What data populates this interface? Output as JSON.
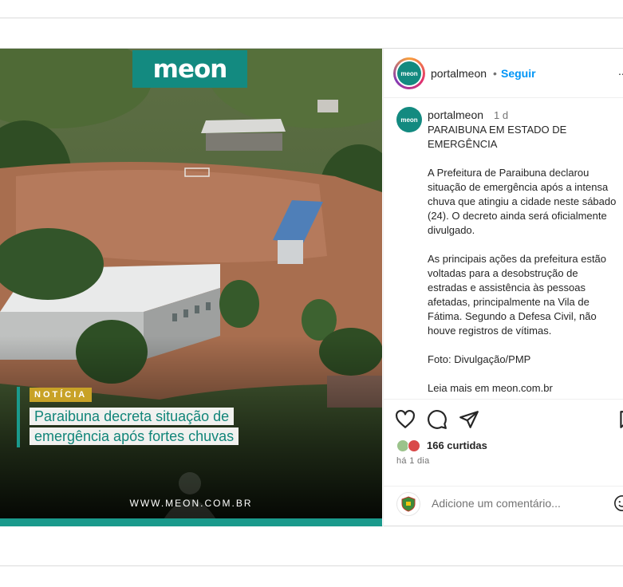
{
  "post": {
    "media": {
      "brand_logo": "meon",
      "tag": "NOTÍCIA",
      "headline": "Paraibuna decreta situação de emergência após fortes chuvas",
      "url_text": "WWW.MEON.COM.BR"
    },
    "header": {
      "avatar_text": "meon",
      "username": "portalmeon",
      "separator": "•",
      "follow_label": "Seguir",
      "more_label": "..."
    },
    "caption": {
      "avatar_text": "meon",
      "username": "portalmeon",
      "time": "1 d",
      "paragraphs": [
        "PARAIBUNA EM ESTADO DE EMERGÊNCIA",
        "A Prefeitura de Paraibuna declarou situação de emergência após a intensa chuva que atingiu a cidade neste sábado (24). O decreto ainda será oficialmente divulgado.",
        "As principais ações da prefeitura estão voltadas para a desobstrução de estradas e assistência às pessoas afetadas, principalmente na Vila de Fátima. Segundo a Defesa Civil, não houve registros de vítimas.",
        "Foto: Divulgação/PMP",
        "Leia mais em meon.com.br"
      ]
    },
    "actions": {
      "icons": [
        "heart-icon",
        "comment-icon",
        "share-icon",
        "bookmark-icon"
      ]
    },
    "likes_text": "166 curtidas",
    "posted_ago": "há 1 dia",
    "comment": {
      "placeholder": "Adicione um comentário..."
    }
  },
  "colors": {
    "brand_teal": "#138a80",
    "tag_gold": "#c8a227",
    "follow_blue": "#0095f6"
  }
}
